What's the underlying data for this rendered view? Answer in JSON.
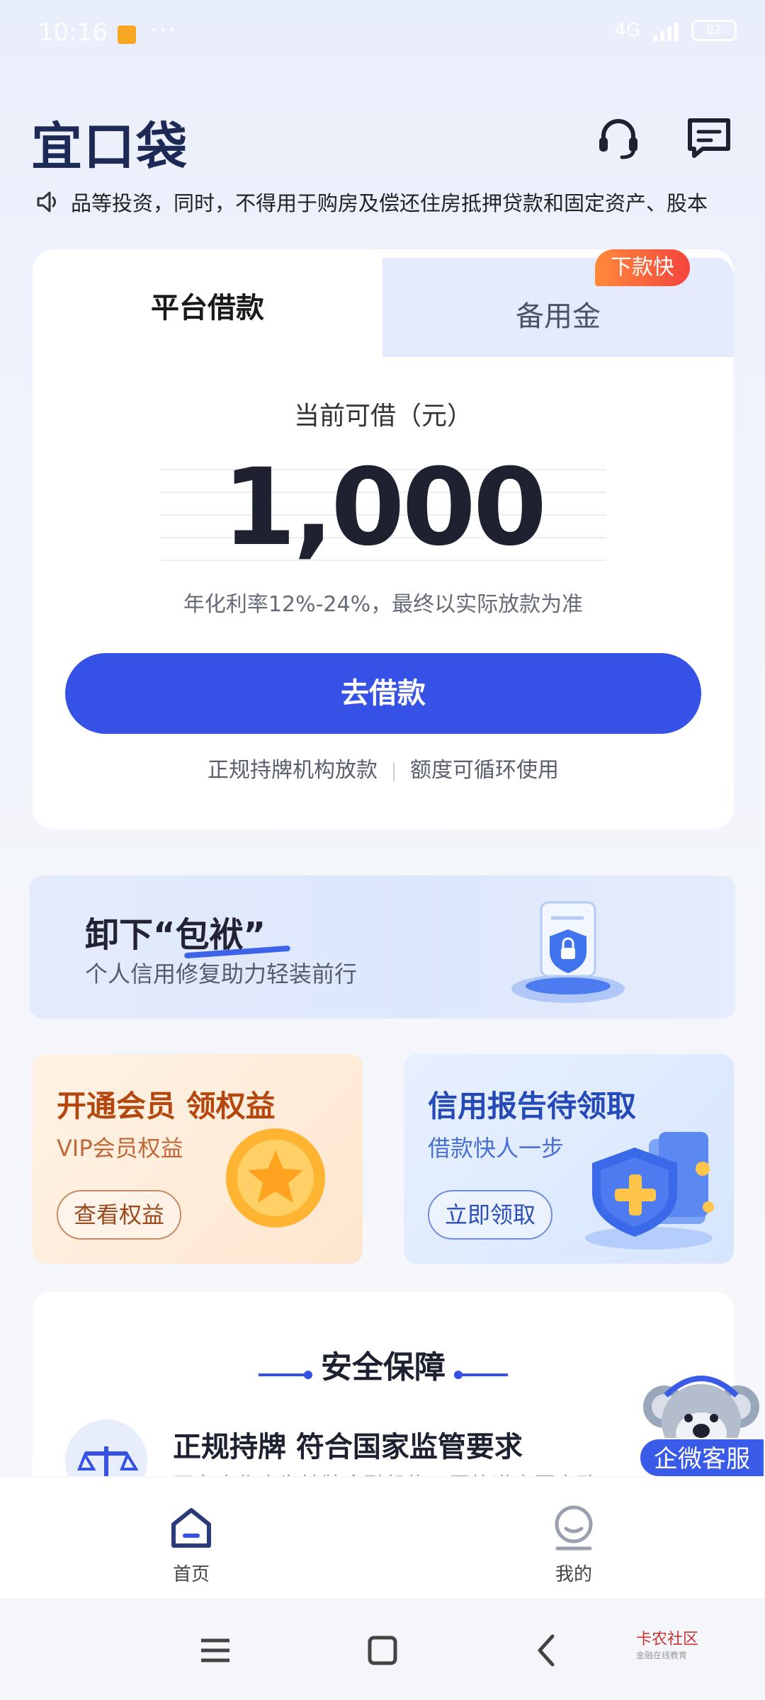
{
  "status_bar": {
    "time": "10:16",
    "dots": "···",
    "network": "4G",
    "battery": "82"
  },
  "header": {
    "logo": "宜口袋",
    "icons": [
      "headset-icon",
      "message-icon"
    ]
  },
  "notice": {
    "text": "品等投资，同时，不得用于购房及偿还住房抵押贷款和固定资产、股本"
  },
  "loan_card": {
    "tab_active": "平台借款",
    "tab_inactive": "备用金",
    "badge": "下款快",
    "available_label": "当前可借（元）",
    "amount": "1,000",
    "rate_text": "年化利率12%-24%，最终以实际放款为准",
    "button_label": "去借款",
    "feature_1": "正规持牌机构放款",
    "feature_2": "额度可循环使用"
  },
  "banner": {
    "title": "卸下“包袱”",
    "subtitle": "个人信用修复助力轻装前行"
  },
  "promo_vip": {
    "title": "开通会员 领权益",
    "subtitle": "VIP会员权益",
    "button": "查看权益"
  },
  "promo_credit": {
    "title": "信用报告待领取",
    "subtitle": "借款快人一步",
    "button": "立即领取"
  },
  "security": {
    "title": "安全保障",
    "heading": "正规持牌 符合国家监管要求",
    "desc": "平台合作方为持牌金融机构，严格遵守国家政"
  },
  "float_cs": {
    "label": "企微客服"
  },
  "bottom_nav": {
    "home": "首页",
    "mine": "我的"
  },
  "watermark": {
    "title": "卡农社区",
    "sub": "金融在线教育"
  },
  "colors": {
    "primary": "#3652e6",
    "badge": "#f4453c",
    "logo": "#1e2a56"
  }
}
